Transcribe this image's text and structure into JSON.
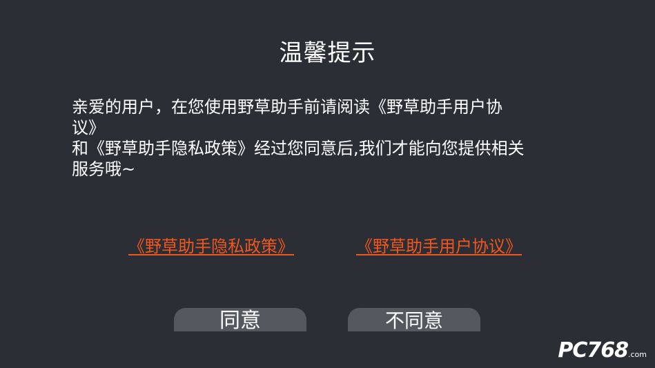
{
  "dialog": {
    "title": "温馨提示",
    "message_lines": [
      "亲爱的用户，在您使用野草助手前请阅读《野草助手用户协",
      "议》",
      "和《野草助手隐私政策》经过您同意后,我们才能向您提供相关",
      "服务哦~"
    ],
    "links": {
      "privacy_policy": "《野草助手隐私政策》",
      "user_agreement": "《野草助手用户协议》"
    },
    "buttons": {
      "agree": "同意",
      "disagree": "不同意"
    }
  },
  "watermark": {
    "logo": "PC768",
    "domain": ".com"
  },
  "colors": {
    "background": "#2b2e35",
    "link": "#f0571e",
    "button": "#55595f",
    "text": "#ffffff"
  }
}
